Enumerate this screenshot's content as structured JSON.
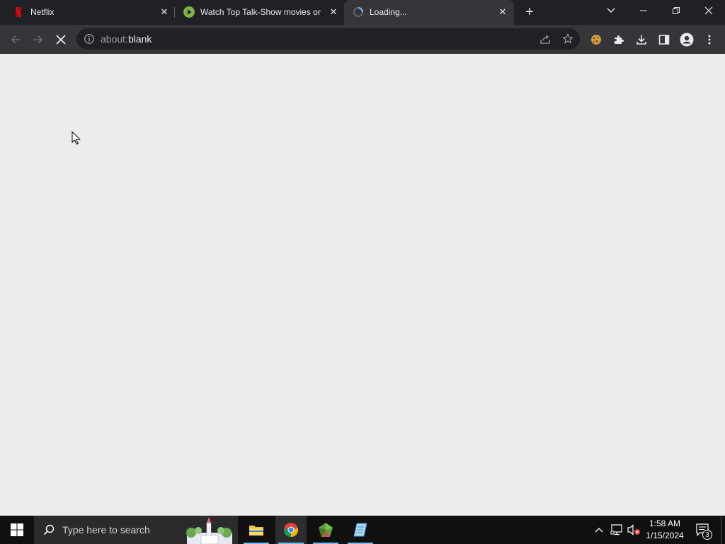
{
  "tabs": [
    {
      "title": "Netflix",
      "favicon": "netflix-logo-icon",
      "active": false
    },
    {
      "title": "Watch Top Talk-Show movies on",
      "favicon": "play-circle-icon",
      "active": false
    },
    {
      "title": "Loading...",
      "favicon": "loading-spinner-icon",
      "active": true
    }
  ],
  "new_tab_label": "+",
  "address_bar": {
    "scheme": "about:",
    "rest": "blank"
  },
  "taskbar": {
    "search_placeholder": "Type here to search",
    "time": "1:58 AM",
    "date": "1/15/2024",
    "notification_count": "3"
  },
  "colors": {
    "tabstrip": "#202124",
    "toolbar": "#35363a",
    "content": "#ececec",
    "taskbar": "#101010",
    "netflix_red": "#e50914",
    "play_green": "#7cb342"
  }
}
